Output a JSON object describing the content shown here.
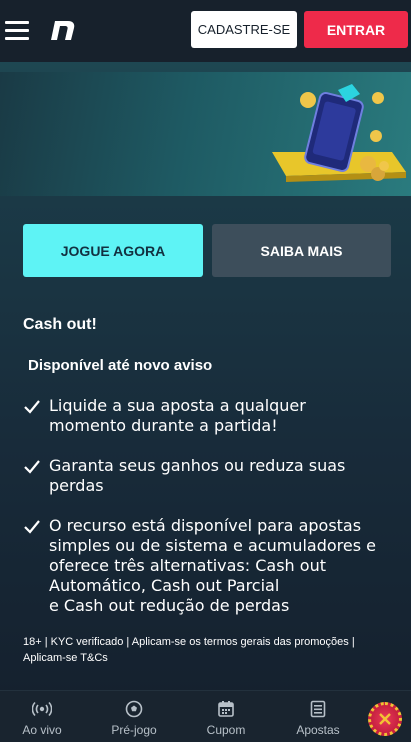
{
  "header": {
    "register_label": "CADASTRE-SE",
    "login_label": "ENTRAR"
  },
  "actions": {
    "play_label": "JOGUE AGORA",
    "more_label": "SAIBA MAIS"
  },
  "promo": {
    "title": "Cash out!",
    "subtitle": "Disponível até novo aviso",
    "features": [
      [
        "Liquide a sua aposta a qualquer",
        "momento durante a partida!"
      ],
      [
        "Garanta seus ganhos ou reduza suas",
        "perdas"
      ],
      [
        "O recurso está disponível para apostas",
        "simples ou de sistema e acumuladores e",
        "oferece três alternativas: Cash out",
        "Automático, Cash out Parcial",
        "e Cash out redução de perdas"
      ]
    ],
    "disclaimer": [
      "18+ | KYC verificado | Aplicam-se os termos gerais das promoções |",
      "Aplicam-se T&Cs"
    ]
  },
  "bottom_nav": [
    {
      "label": "Ao vivo",
      "icon": "live-broadcast-icon"
    },
    {
      "label": "Pré-jogo",
      "icon": "soccer-ball-icon"
    },
    {
      "label": "Cupom",
      "icon": "calendar-icon"
    },
    {
      "label": "Apostas",
      "icon": "bet-slip-icon"
    }
  ],
  "colors": {
    "accent_cyan": "#5ef3f5",
    "brand_red": "#ee2a4a",
    "header_bg": "#17212c"
  }
}
